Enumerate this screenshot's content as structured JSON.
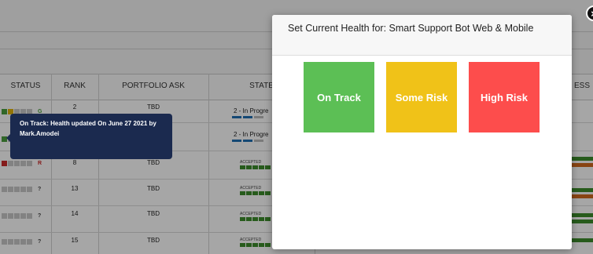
{
  "table": {
    "headers": {
      "status": "STATUS",
      "rank": "RANK",
      "portfolio_ask": "PORTFOLIO ASK",
      "state": "STATE",
      "progress_partial": "ESS"
    },
    "rows": [
      {
        "status_letter": "G",
        "rank": "2",
        "ask": "TBD",
        "state": "2 - In Progre"
      },
      {
        "status_letter": "",
        "rank": "",
        "ask": "",
        "state": "2 - In Progre"
      },
      {
        "status_letter": "R",
        "rank": "8",
        "ask": "TBD",
        "state": "ACCEPTED"
      },
      {
        "status_letter": "?",
        "rank": "13",
        "ask": "TBD",
        "state": "ACCEPTED"
      },
      {
        "status_letter": "?",
        "rank": "14",
        "ask": "TBD",
        "state": "ACCEPTED"
      },
      {
        "status_letter": "?",
        "rank": "15",
        "ask": "TBD",
        "state": "ACCEPTED"
      }
    ]
  },
  "tooltip": {
    "text": "On Track: Health updated On June 27 2021 by Mark.Amodei"
  },
  "modal": {
    "title": "Set Current Health for: Smart Support Bot Web & Mobile",
    "options": [
      {
        "label": "On Track",
        "color": "#5cbf55"
      },
      {
        "label": "Some Risk",
        "color": "#f0c218"
      },
      {
        "label": "High Risk",
        "color": "#fd4d4c"
      }
    ],
    "close_label": "×"
  }
}
